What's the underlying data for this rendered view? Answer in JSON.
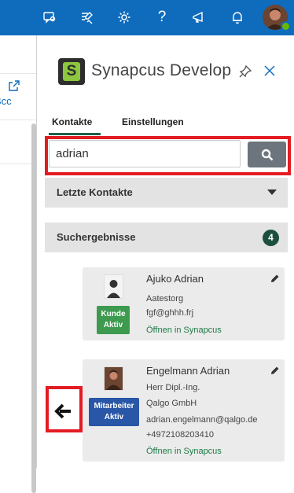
{
  "topbar": {
    "icons": [
      "people-chat-icon",
      "compose-check-icon",
      "gear-icon",
      "help-icon",
      "megaphone-icon",
      "bell-icon"
    ],
    "help_glyph": "?"
  },
  "leftpane": {
    "bcc_label": "Bcc"
  },
  "addin": {
    "title": "Synapcus Develop",
    "logo_letter": "S",
    "tabs": [
      {
        "label": "Kontakte",
        "active": true
      },
      {
        "label": "Einstellungen",
        "active": false
      }
    ],
    "search": {
      "value": "adrian",
      "placeholder": ""
    },
    "sections": {
      "recent": "Letzte Kontakte",
      "results": "Suchergebnisse",
      "results_count": "4"
    },
    "contacts": [
      {
        "name": "Ajuko Adrian",
        "label_line1": "Kunde",
        "label_line2": "Aktiv",
        "label_color": "#3d9a4f",
        "lines": [
          "Aatestorg",
          "fgf@ghhh.frj"
        ],
        "open_link": "Öffnen in Synapcus"
      },
      {
        "name": "Engelmann Adrian",
        "label_line1": "Mitarbeiter",
        "label_line2": "Aktiv",
        "label_color": "#2956a6",
        "lines": [
          "Herr Dipl.-Ing.",
          "Qalgo GmbH",
          "adrian.engelmann@qalgo.de",
          "+4972108203410"
        ],
        "open_link": "Öffnen in Synapcus"
      }
    ]
  },
  "colors": {
    "topbar": "#0f6cbd",
    "highlight": "#e31b23",
    "accent_green": "#1c4f3e",
    "link_green": "#1d7a46"
  }
}
